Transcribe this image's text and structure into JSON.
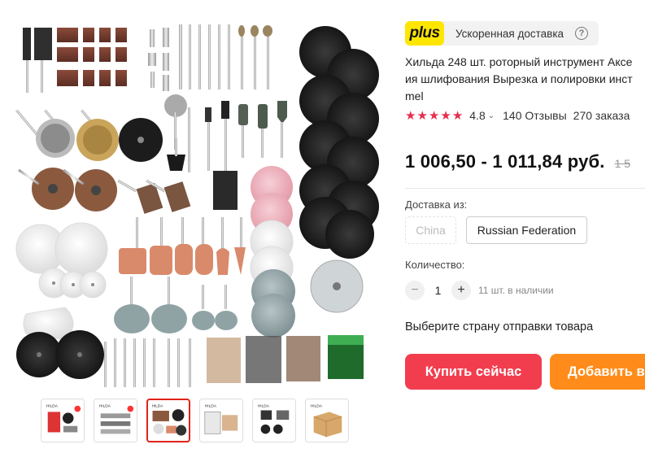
{
  "gallery": {
    "thumbnails": [
      {
        "brand": "HILDA",
        "active": false
      },
      {
        "brand": "HILDA",
        "active": false
      },
      {
        "brand": "HILDA",
        "active": true
      },
      {
        "brand": "HILDA",
        "active": false
      },
      {
        "brand": "HILDA",
        "active": false
      },
      {
        "brand": "HILDA",
        "active": false
      }
    ]
  },
  "delivery_badge": {
    "logo": "plus",
    "text": "Ускоренная доставка",
    "help_icon": "?"
  },
  "product": {
    "title_lines": [
      "Хильда 248 шт. роторный инструмент Аксе",
      "ия шлифования Вырезка и полировки инст",
      "mel"
    ],
    "rating": "4.8",
    "stars_filled": 5,
    "reviews": "140 Отзывы",
    "orders": "270 заказа",
    "price": "1 006,50 - 1 011,84 руб.",
    "old_price": "1 5"
  },
  "shipping": {
    "label": "Доставка из:",
    "options": [
      {
        "label": "China",
        "disabled": true
      },
      {
        "label": "Russian Federation",
        "disabled": false
      }
    ]
  },
  "quantity": {
    "label": "Количество:",
    "minus": "−",
    "value": "1",
    "plus": "+",
    "stock": "11 шт. в наличии"
  },
  "choose_ship_text": "Выберите страну отправки товара",
  "buttons": {
    "buy_now": "Купить сейчас",
    "add_to_cart": "Добавить в корзину"
  },
  "colors": {
    "buy_button": "#f23d4f",
    "cart_button": "#ff8c1a",
    "stars": "#e62e4d",
    "plus_badge": "#ffe600"
  }
}
